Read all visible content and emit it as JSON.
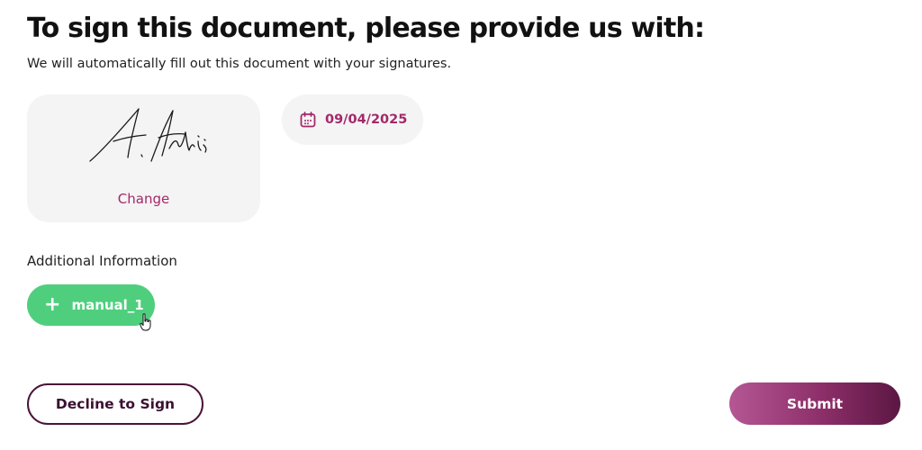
{
  "header": {
    "title": "To sign this document, please provide us with:",
    "subtitle": "We will automatically fill out this document with your signatures."
  },
  "signature": {
    "change_label": "Change"
  },
  "date_field": {
    "value": "09/04/2025",
    "icon": "calendar-icon"
  },
  "additional_info": {
    "label": "Additional Information",
    "button_label": "manual_1",
    "button_icon": "+"
  },
  "actions": {
    "decline_label": "Decline to Sign",
    "submit_label": "Submit"
  },
  "colors": {
    "accent": "#a3296a",
    "primary_dark": "#4a1436",
    "success_green": "#4fcf7e",
    "card_bg": "#f4f4f4"
  }
}
